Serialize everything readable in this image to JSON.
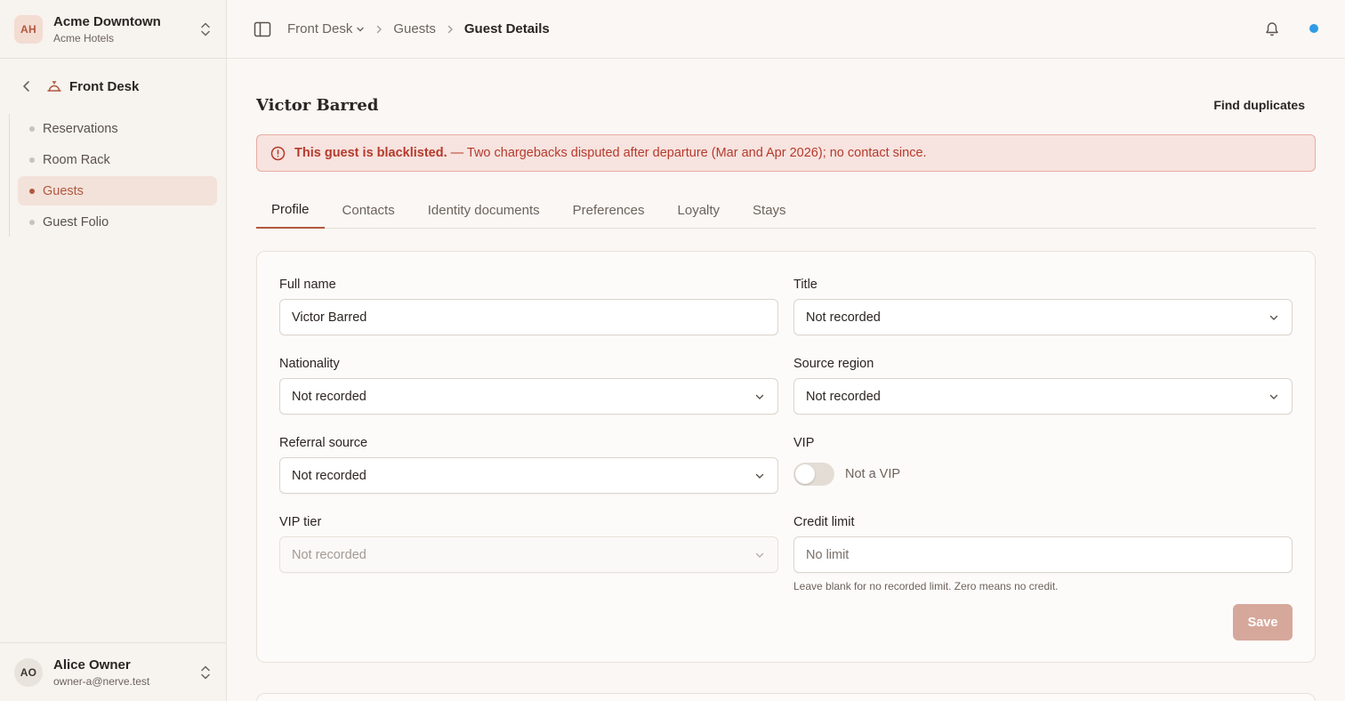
{
  "org": {
    "initials": "AH",
    "name": "Acme Downtown",
    "sub": "Acme Hotels"
  },
  "module": {
    "title": "Front Desk"
  },
  "nav": {
    "items": [
      {
        "label": "Reservations",
        "active": false
      },
      {
        "label": "Room Rack",
        "active": false
      },
      {
        "label": "Guests",
        "active": true
      },
      {
        "label": "Guest Folio",
        "active": false
      }
    ]
  },
  "user": {
    "initials": "AO",
    "name": "Alice Owner",
    "email": "owner-a@nerve.test"
  },
  "breadcrumb": {
    "root": "Front Desk",
    "parent": "Guests",
    "current": "Guest Details"
  },
  "page": {
    "title": "Victor Barred",
    "find_duplicates": "Find duplicates"
  },
  "alert": {
    "strong": "This guest is blacklisted.",
    "detail": "— Two chargebacks disputed after departure (Mar and Apr 2026); no contact since."
  },
  "tabs": [
    "Profile",
    "Contacts",
    "Identity documents",
    "Preferences",
    "Loyalty",
    "Stays"
  ],
  "form": {
    "full_name": {
      "label": "Full name",
      "value": "Victor Barred"
    },
    "title": {
      "label": "Title",
      "value": "Not recorded"
    },
    "nationality": {
      "label": "Nationality",
      "value": "Not recorded"
    },
    "source_region": {
      "label": "Source region",
      "value": "Not recorded"
    },
    "referral_source": {
      "label": "Referral source",
      "value": "Not recorded"
    },
    "vip": {
      "label": "VIP",
      "toggle_label": "Not a VIP",
      "on": false
    },
    "vip_tier": {
      "label": "VIP tier",
      "value": "Not recorded"
    },
    "credit_limit": {
      "label": "Credit limit",
      "placeholder": "No limit",
      "hint": "Leave blank for no recorded limit. Zero means no credit."
    },
    "save_label": "Save"
  },
  "colors": {
    "accent": "#b2573e",
    "alert_text": "#b43a2c",
    "status_dot": "#2f9be6"
  }
}
